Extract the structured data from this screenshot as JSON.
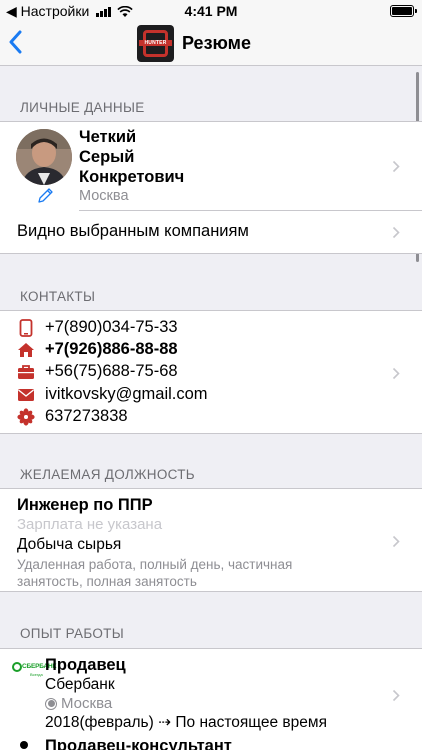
{
  "status_bar": {
    "carrier_back": "◀ Настройки",
    "time": "4:41 PM"
  },
  "navbar": {
    "title": "Резюме",
    "logo_text": "HUNTER"
  },
  "personal": {
    "header": "ЛИЧНЫЕ ДАННЫЕ",
    "name_lines": [
      "Четкий",
      "Серый",
      "Конкретович"
    ],
    "city": "Москва",
    "visibility": "Видно выбранным компаниям"
  },
  "contacts": {
    "header": "КОНТАКТЫ",
    "items": [
      {
        "icon": "mobile-phone-icon",
        "value": "+7(890)034-75-33"
      },
      {
        "icon": "home-phone-icon",
        "value": "+7(926)886-88-88"
      },
      {
        "icon": "work-phone-icon",
        "value": "+56(75)688-75-68"
      },
      {
        "icon": "email-icon",
        "value": "ivitkovsky@gmail.com"
      },
      {
        "icon": "icq-icon",
        "value": "637273838"
      }
    ]
  },
  "position": {
    "header": "ЖЕЛАЕМАЯ ДОЛЖНОСТЬ",
    "title": "Инженер по ППР",
    "salary": "Зарплата не указана",
    "industry": "Добыча сырья",
    "schedule": "Удаленная работа, полный день, частичная занятость, полная занятость"
  },
  "experience": {
    "header": "ОПЫТ РАБОТЫ",
    "logo_text": "СБЕРБАНК",
    "logo_subtext": "Всегда",
    "title": "Продавец",
    "company": "Сбербанк",
    "city": "Москва",
    "period": "2018(февраль) ⇢ По настоящее время",
    "next_title": "Продавец-консультант"
  },
  "colors": {
    "accent": "#1a7bf2",
    "contact_icon": "#c4322c",
    "sberbank": "#1a9f29"
  }
}
